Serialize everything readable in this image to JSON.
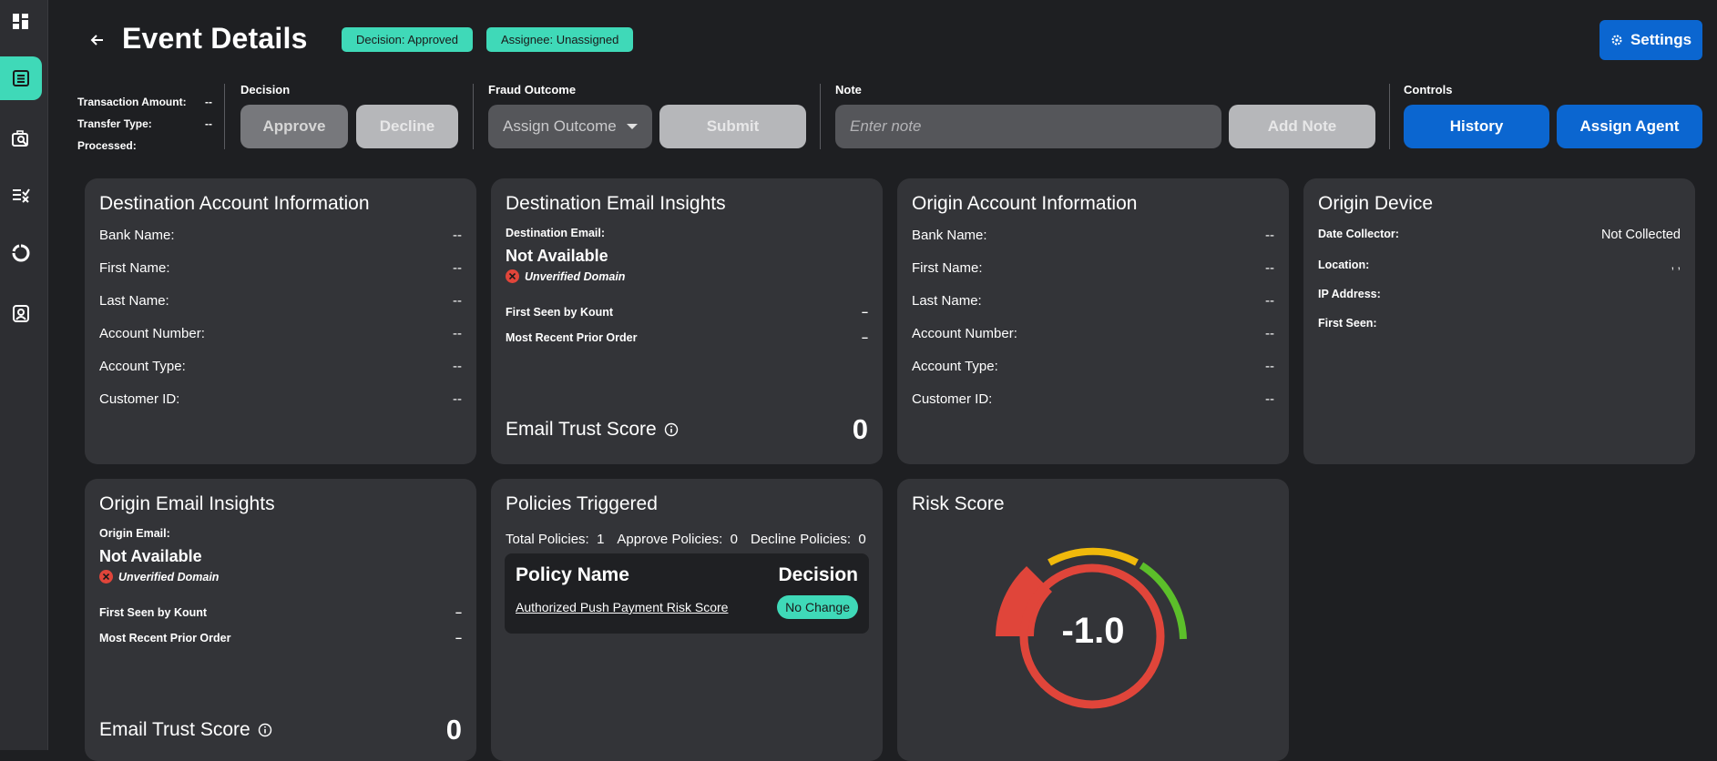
{
  "sidebar": {
    "items": [
      {
        "icon": "dashboard-icon"
      },
      {
        "icon": "event-list-icon",
        "active": true
      },
      {
        "icon": "search-inspect-icon"
      },
      {
        "icon": "rules-list-icon"
      },
      {
        "icon": "circular-chart-icon"
      },
      {
        "icon": "user-settings-icon"
      }
    ]
  },
  "header": {
    "title": "Event Details",
    "decision_badge": "Decision: Approved",
    "assignee_badge": "Assignee: Unassigned",
    "settings_label": "Settings"
  },
  "meta": {
    "transaction_amount_label": "Transaction Amount:",
    "transaction_amount_value": "--",
    "transfer_type_label": "Transfer Type:",
    "transfer_type_value": "--",
    "processed_label": "Processed:",
    "processed_value": ""
  },
  "decision": {
    "label": "Decision",
    "approve": "Approve",
    "decline": "Decline"
  },
  "fraud_outcome": {
    "label": "Fraud Outcome",
    "select_value": "Assign Outcome",
    "submit": "Submit"
  },
  "note": {
    "label": "Note",
    "placeholder": "Enter note",
    "add": "Add Note"
  },
  "controls": {
    "label": "Controls",
    "history": "History",
    "assign_agent": "Assign Agent"
  },
  "destination_account": {
    "title": "Destination Account Information",
    "rows": [
      {
        "k": "Bank Name:",
        "v": "--"
      },
      {
        "k": "First Name:",
        "v": "--"
      },
      {
        "k": "Last Name:",
        "v": "--"
      },
      {
        "k": "Account Number:",
        "v": "--"
      },
      {
        "k": "Account Type:",
        "v": "--"
      },
      {
        "k": "Customer ID:",
        "v": "--"
      }
    ]
  },
  "destination_email": {
    "title": "Destination Email Insights",
    "email_label": "Destination Email:",
    "email_value": "Not Available",
    "domain_status": "Unverified Domain",
    "first_seen_label": "First Seen by Kount",
    "first_seen_value": "–",
    "recent_order_label": "Most Recent Prior Order",
    "recent_order_value": "–",
    "trust_label": "Email Trust Score",
    "trust_score": "0"
  },
  "origin_account": {
    "title": "Origin Account Information",
    "rows": [
      {
        "k": "Bank Name:",
        "v": "--"
      },
      {
        "k": "First Name:",
        "v": "--"
      },
      {
        "k": "Last Name:",
        "v": "--"
      },
      {
        "k": "Account Number:",
        "v": "--"
      },
      {
        "k": "Account Type:",
        "v": "--"
      },
      {
        "k": "Customer ID:",
        "v": "--"
      }
    ]
  },
  "origin_device": {
    "title": "Origin Device",
    "date_collector_label": "Date Collector:",
    "date_collector_value": "Not Collected",
    "location_label": "Location:",
    "location_value": ", ,",
    "ip_label": "IP Address:",
    "first_seen_label": "First Seen:"
  },
  "origin_email": {
    "title": "Origin Email Insights",
    "email_label": "Origin Email:",
    "email_value": "Not Available",
    "domain_status": "Unverified Domain",
    "first_seen_label": "First Seen by Kount",
    "first_seen_value": "–",
    "recent_order_label": "Most Recent Prior Order",
    "recent_order_value": "–",
    "trust_label": "Email Trust Score",
    "trust_score": "0"
  },
  "policies": {
    "title": "Policies Triggered",
    "total_label": "Total Policies:",
    "total_value": "1",
    "approve_label": "Approve Policies:",
    "approve_value": "0",
    "decline_label": "Decline Policies:",
    "decline_value": "0",
    "col_name": "Policy Name",
    "col_decision": "Decision",
    "rows": [
      {
        "name": "Authorized Push Payment Risk Score",
        "decision": "No Change"
      }
    ]
  },
  "risk": {
    "title": "Risk Score",
    "value": "-1.0",
    "colors": {
      "low": "#5cbf2a",
      "mid": "#f0b90b",
      "high": "#e0453a"
    }
  }
}
